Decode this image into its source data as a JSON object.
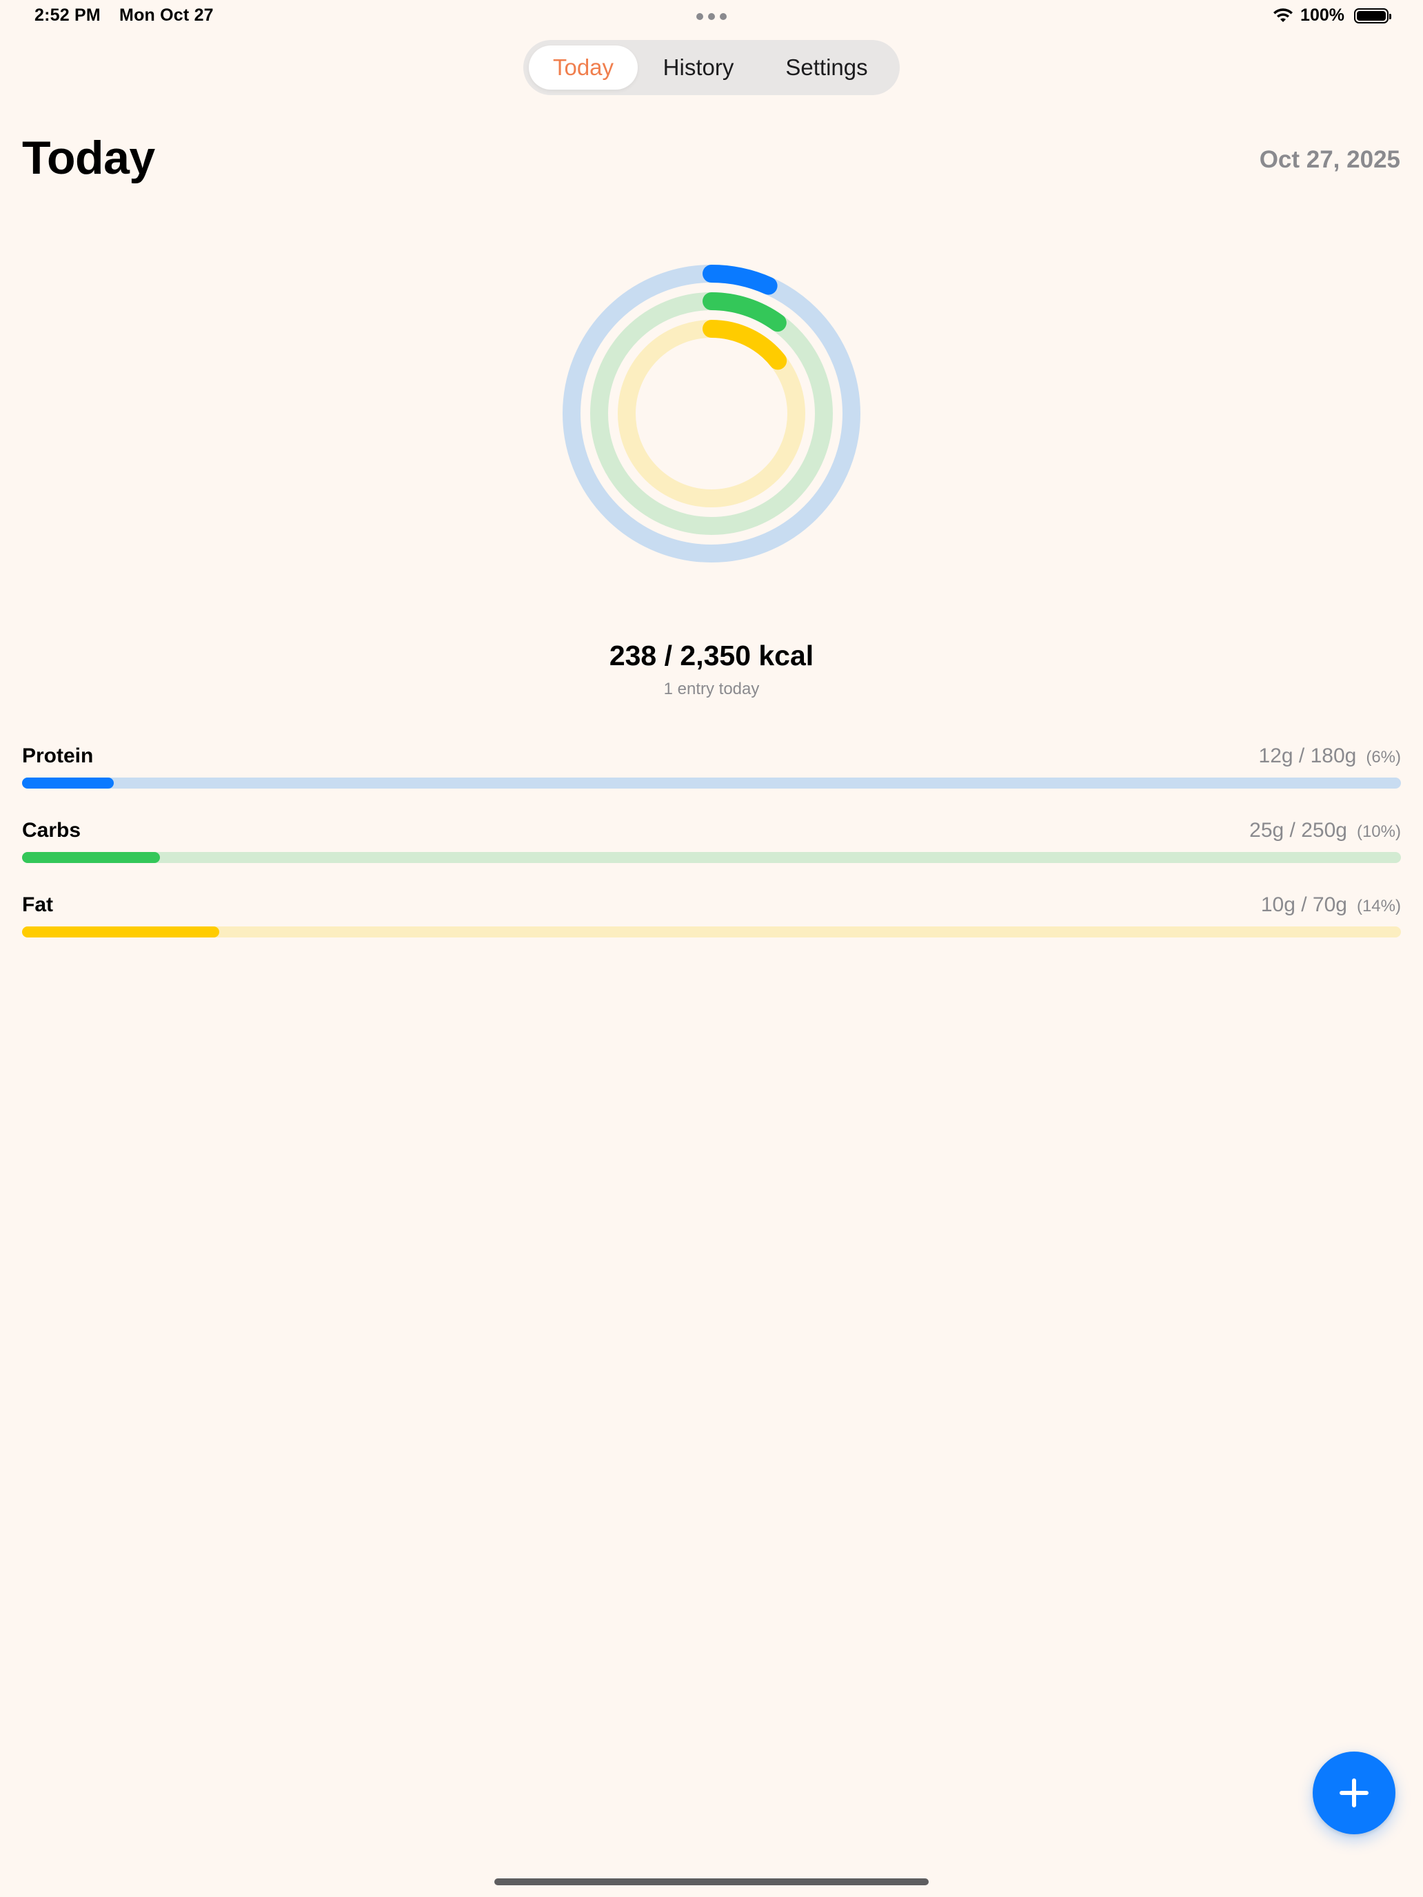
{
  "status_bar": {
    "time": "2:52 PM",
    "date": "Mon Oct 27",
    "battery": "100%",
    "icons": [
      "wifi-icon",
      "battery-icon"
    ]
  },
  "tabs": [
    {
      "label": "Today",
      "active": true
    },
    {
      "label": "History",
      "active": false
    },
    {
      "label": "Settings",
      "active": false
    }
  ],
  "header": {
    "title": "Today",
    "date": "Oct 27, 2025"
  },
  "calories": {
    "summary": "238 / 2,350 kcal",
    "consumed": 238,
    "goal": 2350,
    "subtitle": "1 entry today"
  },
  "macros": [
    {
      "name": "Protein",
      "amount": "12g / 180g",
      "percent_label": "(6%)",
      "progress": 0.0667,
      "color": "#0A7AFF",
      "track_color": "#C8DCF1"
    },
    {
      "name": "Carbs",
      "amount": "25g / 250g",
      "percent_label": "(10%)",
      "progress": 0.1,
      "color": "#34C759",
      "track_color": "#D3EBD2"
    },
    {
      "name": "Fat",
      "amount": "10g / 70g",
      "percent_label": "(14%)",
      "progress": 0.1429,
      "color": "#FFCC00",
      "track_color": "#FCEEC0"
    }
  ],
  "accent_color": "#F07F4E",
  "fab": {
    "icon": "plus-icon",
    "color": "#0A7AFF"
  }
}
